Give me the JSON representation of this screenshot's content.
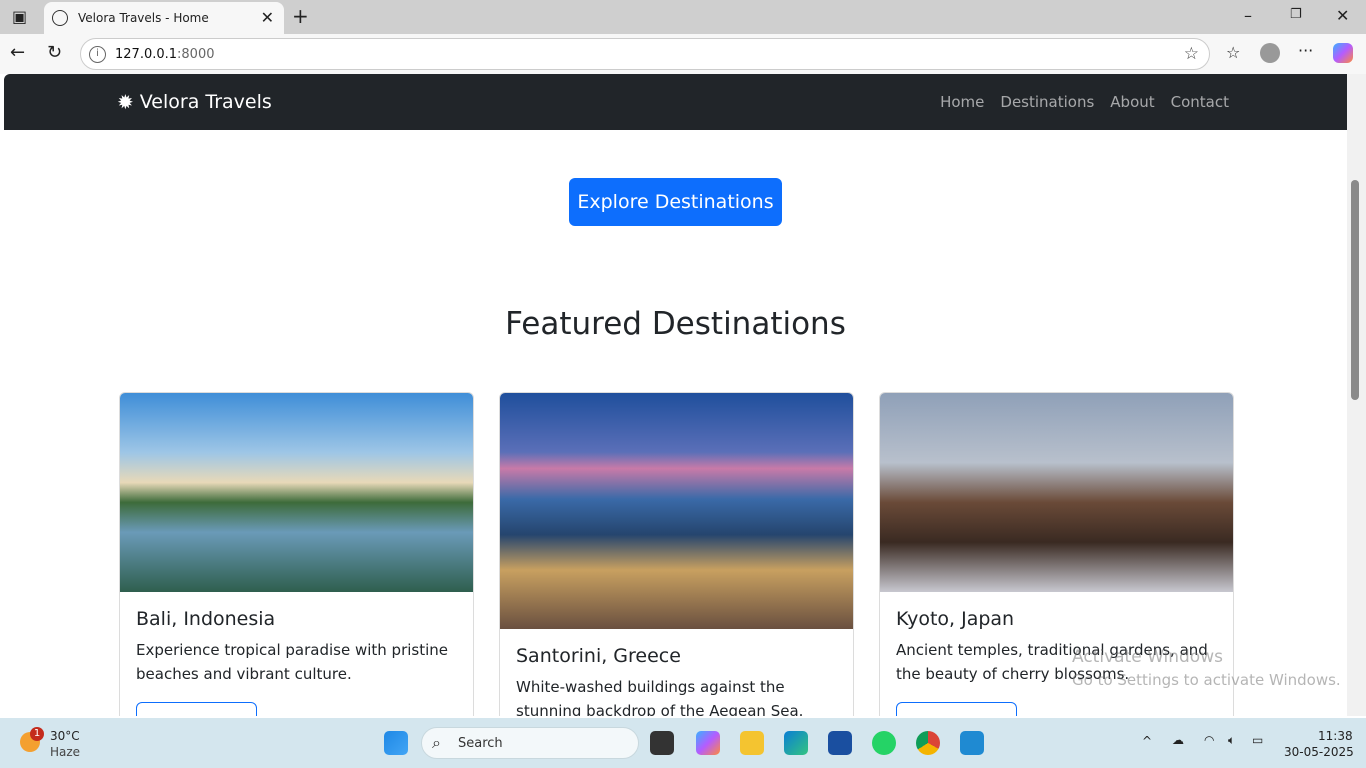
{
  "browser": {
    "tab_title": "Velora Travels - Home",
    "url_host": "127.0.0.1",
    "url_port": ":8000"
  },
  "nav": {
    "brand": "Velora Travels",
    "links": [
      "Home",
      "Destinations",
      "About",
      "Contact"
    ]
  },
  "hero": {
    "cta": "Explore Destinations"
  },
  "featured": {
    "heading": "Featured Destinations",
    "cards": [
      {
        "title": "Bali, Indonesia",
        "text": "Experience tropical paradise with pristine beaches and vibrant culture."
      },
      {
        "title": "Santorini, Greece",
        "text": "White-washed buildings against the stunning backdrop of the Aegean Sea."
      },
      {
        "title": "Kyoto, Japan",
        "text": "Ancient temples, traditional gardens, and the beauty of cherry blossoms."
      }
    ]
  },
  "watermark": {
    "title": "Activate Windows",
    "sub": "Go to Settings to activate Windows."
  },
  "taskbar": {
    "temp": "30°C",
    "weather": "Haze",
    "badge": "1",
    "search": "Search",
    "time": "11:38",
    "date": "30-05-2025"
  }
}
